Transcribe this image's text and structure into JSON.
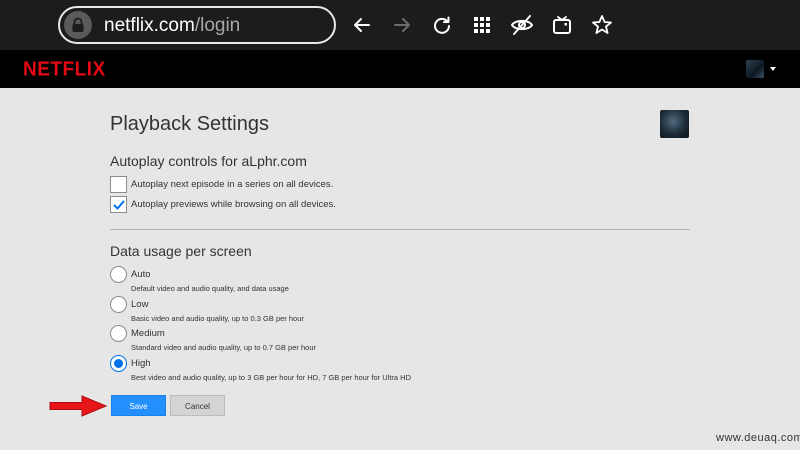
{
  "browser": {
    "url_host": "netflix.com",
    "url_path": "/login",
    "icons": [
      "lock-icon",
      "back-icon",
      "forward-icon",
      "reload-icon",
      "apps-grid-icon",
      "hide-eye-icon",
      "tv-icon",
      "star-icon"
    ]
  },
  "header": {
    "logo_text": "NETFLIX",
    "logo_color": "#e50914"
  },
  "page": {
    "title": "Playback Settings",
    "autoplay": {
      "heading": "Autoplay controls for aLphr.com",
      "options": [
        {
          "label": "Autoplay next episode in a series on all devices.",
          "checked": false
        },
        {
          "label": "Autoplay previews while browsing on all devices.",
          "checked": true
        }
      ]
    },
    "data_usage": {
      "heading": "Data usage per screen",
      "options": [
        {
          "label": "Auto",
          "description": "Default video and audio quality, and data usage",
          "selected": false
        },
        {
          "label": "Low",
          "description": "Basic video and audio quality, up to 0.3 GB per hour",
          "selected": false
        },
        {
          "label": "Medium",
          "description": "Standard video and audio quality, up to 0.7 GB per hour",
          "selected": false
        },
        {
          "label": "High",
          "description": "Best video and audio quality, up to 3 GB per hour for HD, 7 GB per hour for Ultra HD",
          "selected": true
        }
      ]
    },
    "buttons": {
      "save": "Save",
      "cancel": "Cancel"
    },
    "accent_color": "#0071eb"
  },
  "watermark": "www.deuaq.com"
}
